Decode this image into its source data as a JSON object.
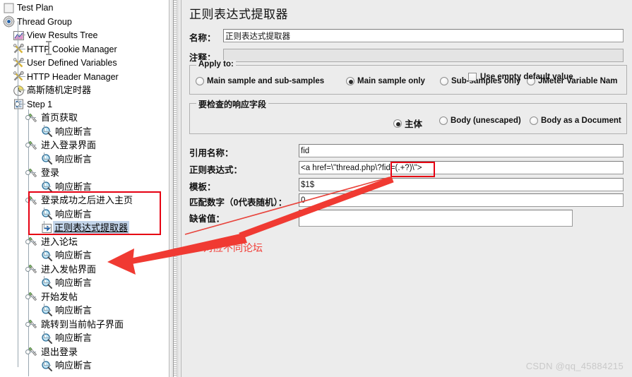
{
  "tree": {
    "root_label": "Test Plan",
    "items": [
      {
        "label": "Test Plan",
        "icon": "testplan-icon",
        "depth": 0,
        "cjk": false,
        "selected": false
      },
      {
        "label": "Thread Group",
        "icon": "gear-icon",
        "depth": 0,
        "cjk": false,
        "selected": false
      },
      {
        "label": "View Results Tree",
        "icon": "chart-icon",
        "depth": 1,
        "cjk": false,
        "selected": false
      },
      {
        "label": "HTTP Cookie Manager",
        "icon": "wrench-icon",
        "depth": 1,
        "cjk": false,
        "selected": false
      },
      {
        "label": "User Defined Variables",
        "icon": "wrench-icon",
        "depth": 1,
        "cjk": false,
        "selected": false
      },
      {
        "label": "HTTP Header Manager",
        "icon": "wrench-icon",
        "depth": 1,
        "cjk": false,
        "selected": false
      },
      {
        "label": "高斯随机定时器",
        "icon": "clock-icon",
        "depth": 1,
        "cjk": true,
        "selected": false
      },
      {
        "label": "Step 1",
        "icon": "controller-icon",
        "depth": 1,
        "cjk": false,
        "selected": false
      },
      {
        "label": "首页获取",
        "icon": "sampler-icon",
        "depth": 2,
        "cjk": true,
        "selected": false
      },
      {
        "label": "响应断言",
        "icon": "assertion-icon",
        "depth": 3,
        "cjk": true,
        "selected": false
      },
      {
        "label": "进入登录界面",
        "icon": "sampler-icon",
        "depth": 2,
        "cjk": true,
        "selected": false
      },
      {
        "label": "响应断言",
        "icon": "assertion-icon",
        "depth": 3,
        "cjk": true,
        "selected": false
      },
      {
        "label": "登录",
        "icon": "sampler-icon",
        "depth": 2,
        "cjk": true,
        "selected": false
      },
      {
        "label": "响应断言",
        "icon": "assertion-icon",
        "depth": 3,
        "cjk": true,
        "selected": false
      },
      {
        "label": "登录成功之后进入主页",
        "icon": "sampler-icon",
        "depth": 2,
        "cjk": true,
        "selected": false
      },
      {
        "label": "响应断言",
        "icon": "assertion-icon",
        "depth": 3,
        "cjk": true,
        "selected": false
      },
      {
        "label": "正则表达式提取器",
        "icon": "extractor-icon",
        "depth": 3,
        "cjk": true,
        "selected": true
      },
      {
        "label": "进入论坛",
        "icon": "sampler-icon",
        "depth": 2,
        "cjk": true,
        "selected": false
      },
      {
        "label": "响应断言",
        "icon": "assertion-icon",
        "depth": 3,
        "cjk": true,
        "selected": false
      },
      {
        "label": "进入发帖界面",
        "icon": "sampler-icon",
        "depth": 2,
        "cjk": true,
        "selected": false
      },
      {
        "label": "响应断言",
        "icon": "assertion-icon",
        "depth": 3,
        "cjk": true,
        "selected": false
      },
      {
        "label": "开始发帖",
        "icon": "sampler-icon",
        "depth": 2,
        "cjk": true,
        "selected": false
      },
      {
        "label": "响应断言",
        "icon": "assertion-icon",
        "depth": 3,
        "cjk": true,
        "selected": false
      },
      {
        "label": "跳转到当前帖子界面",
        "icon": "sampler-icon",
        "depth": 2,
        "cjk": true,
        "selected": false
      },
      {
        "label": "响应断言",
        "icon": "assertion-icon",
        "depth": 3,
        "cjk": true,
        "selected": false
      },
      {
        "label": "退出登录",
        "icon": "sampler-icon",
        "depth": 2,
        "cjk": true,
        "selected": false
      },
      {
        "label": "响应断言",
        "icon": "assertion-icon",
        "depth": 3,
        "cjk": true,
        "selected": false
      }
    ]
  },
  "panel": {
    "title": "正则表达式提取器",
    "name_label": "名称：",
    "name_value": "正则表达式提取器",
    "comment_label": "注释：",
    "comment_value": "",
    "apply_to": {
      "title": "Apply to:",
      "options": [
        {
          "label": "Main sample and sub-samples",
          "selected": false
        },
        {
          "label": "Main sample only",
          "selected": true
        },
        {
          "label": "Sub-samples only",
          "selected": false
        },
        {
          "label": "JMeter Variable Nam",
          "selected": false
        }
      ]
    },
    "field_to_check": {
      "title": "要检查的响应字段",
      "options": [
        {
          "label": "主体",
          "selected": true
        },
        {
          "label": "Body (unescaped)",
          "selected": false
        },
        {
          "label": "Body as a Document",
          "selected": false
        }
      ]
    },
    "fields": [
      {
        "label": "引用名称：",
        "value": "fid"
      },
      {
        "label": "正则表达式：",
        "value": "<a href=\\\"thread.php\\?fid=(.+?)\\\">"
      },
      {
        "label": "模板：",
        "value": "$1$"
      },
      {
        "label": "匹配数字（0代表随机）：",
        "value": "0"
      },
      {
        "label": "缺省值：",
        "value": ""
      }
    ],
    "use_empty_default": {
      "label": "Use empty default value",
      "checked": false
    }
  },
  "annotations": {
    "note_text": "对应不同论坛",
    "accent_color": "#e60012",
    "note_color": "#f2403a"
  },
  "watermark": {
    "text": "CSDN @qq_45884215"
  }
}
